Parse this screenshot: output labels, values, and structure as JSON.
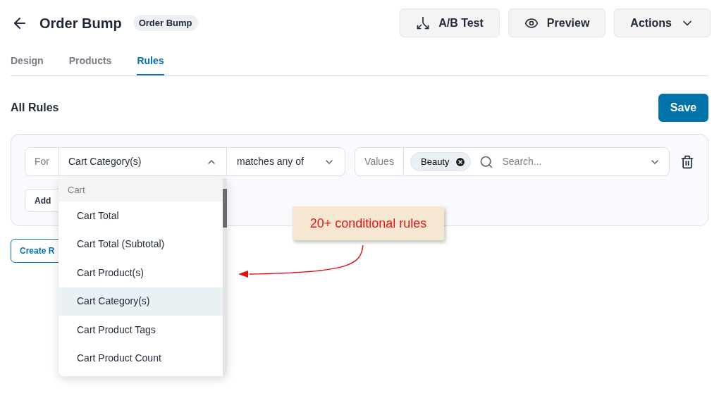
{
  "header": {
    "title": "Order Bump",
    "badge": "Order Bump",
    "buttons": [
      {
        "kind": "ab",
        "label": "A/B Test"
      },
      {
        "kind": "preview",
        "label": "Preview"
      },
      {
        "kind": "menu",
        "label": "Actions"
      }
    ]
  },
  "tabs": [
    {
      "label": "Design",
      "selected": false
    },
    {
      "label": "Products",
      "selected": false
    },
    {
      "label": "Rules",
      "selected": true
    }
  ],
  "section": {
    "title": "All Rules",
    "save": "Save"
  },
  "rule": {
    "prefix": "For",
    "field": "Cart Category(s)",
    "field_expanded": true,
    "operator": "matches any of",
    "values_label": "Values",
    "tags": [
      "Beauty"
    ],
    "search_placeholder": "Search...",
    "add_button": "Add"
  },
  "create_button": "Create R",
  "dropdown": {
    "group": "Cart",
    "items": [
      {
        "label": "Cart Total",
        "selected": false
      },
      {
        "label": "Cart Total (Subtotal)",
        "selected": false
      },
      {
        "label": "Cart Product(s)",
        "selected": false
      },
      {
        "label": "Cart Category(s)",
        "selected": true
      },
      {
        "label": "Cart Product Tags",
        "selected": false
      },
      {
        "label": "Cart Product Count",
        "selected": false
      }
    ]
  },
  "callout": "20+ conditional rules"
}
